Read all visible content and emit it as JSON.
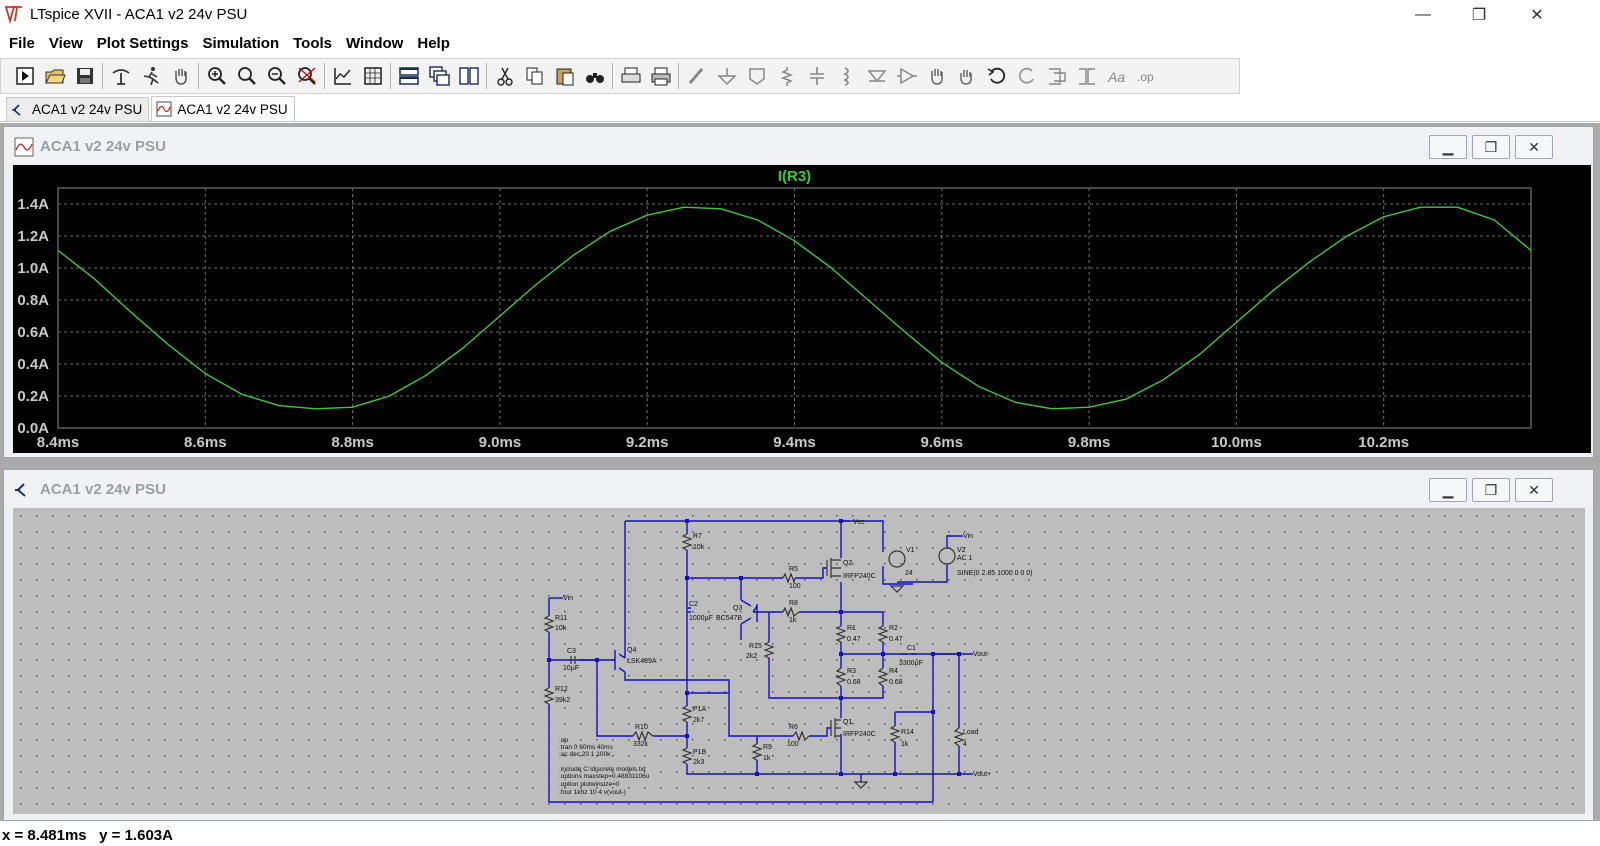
{
  "window": {
    "title": "LTspice XVII - ACA1 v2 24v PSU",
    "controls": {
      "minimize": "—",
      "restore": "❐",
      "close": "✕"
    }
  },
  "menu": [
    "File",
    "View",
    "Plot Settings",
    "Simulation",
    "Tools",
    "Window",
    "Help"
  ],
  "toolbar": {
    "buttons": [
      "run-icon",
      "open-icon",
      "save-icon",
      "control-panel-icon",
      "run-sim-icon",
      "pan-icon",
      "zoom-in-icon",
      "zoom-box-icon",
      "zoom-out-icon",
      "zoom-cancel-icon",
      "autorange-icon",
      "grid-icon",
      "tile-horizontal-icon",
      "cascade-icon",
      "tile-vertical-icon",
      "cut-icon",
      "copy-icon",
      "paste-icon",
      "find-icon",
      "print-setup-icon",
      "print-icon",
      "wire-icon",
      "ground-icon",
      "label-net-icon",
      "resistor-icon",
      "capacitor-icon",
      "inductor-icon",
      "diode-icon",
      "component-icon",
      "move-icon",
      "drag-icon",
      "undo-icon",
      "redo-icon",
      "rotate-icon",
      "mirror-icon",
      "text-icon",
      "spice-directive-icon"
    ]
  },
  "tabs": [
    {
      "label": "ACA1 v2 24v PSU",
      "icon": "schematic-icon"
    },
    {
      "label": "ACA1 v2 24v PSU",
      "icon": "waveform-icon",
      "active": true
    }
  ],
  "plot_window": {
    "title": "ACA1 v2 24v PSU",
    "trace_label": "I(R3)",
    "trace_color": "#3cc83c"
  },
  "schematic_window": {
    "title": "ACA1 v2 24v PSU",
    "wire_color": "#0000c8",
    "labels": {
      "vcc": "Vcc",
      "vin_top": "Vin",
      "vin_left": "Vin",
      "vout_minus": "Vout-",
      "vout_plus": "Vout+",
      "v1": "V1",
      "v1_val": "24",
      "v2": "V2",
      "v2_ac": "AC 1",
      "v2_sine": "SINE(0 2.85 1000 0 0 0)",
      "r7": "R7",
      "r7_val": "10k",
      "r5": "R5",
      "r5_val": "100",
      "q2": "Q2",
      "q2_val": "IRFP240C",
      "c2": "C2",
      "c2_val": "1000µF",
      "q3": "Q3",
      "q3_val": "BC547B",
      "r8": "R8",
      "r8_val": "1k",
      "r11": "R11",
      "r11_val": "10k",
      "c3": "C3",
      "c3_val": "10µF",
      "q4": "Q4",
      "q4_val": "LSK489A",
      "r15": "R15",
      "r15_val": "2k2",
      "r1": "R1",
      "r1_val": "0.47",
      "r2": "R2",
      "r2_val": "0.47",
      "c1": "C1",
      "c1_val": "3300µF",
      "r3": "R3",
      "r3_val": "0.68",
      "r4": "R4",
      "r4_val": "0.68",
      "r12": "R12",
      "r12_val": "39k2",
      "p1a": "P1A",
      "p1a_val": "2k7",
      "r10": "R10",
      "r10_val": "332k",
      "r6": "R6",
      "r6_val": "100",
      "q1": "Q1",
      "q1_val": "IRFP240C",
      "r14": "R14",
      "r14_val": "1k",
      "load": "Load",
      "load_val": "4",
      "r9": "R9",
      "r9_val": "1k",
      "p1b": "P1B",
      "p1b_val": "2k3"
    },
    "directives": [
      ".op",
      ".tran 0 60ms 40ms",
      ";ac dec 20 1 100k",
      ".include C:\\discrete models.txt",
      ".options maxstep=0.48831106u",
      ".option plotwinsize=0",
      ".four 1khz 10 4 v(vout-)"
    ]
  },
  "status": {
    "text": "x = 8.481ms   y = 1.603A"
  },
  "chart_data": {
    "type": "line",
    "title": "I(R3)",
    "xlabel": "",
    "ylabel": "",
    "xlim": [
      8.4,
      10.4
    ],
    "ylim": [
      0.0,
      1.5
    ],
    "x_ticks": [
      "8.4ms",
      "8.6ms",
      "8.8ms",
      "9.0ms",
      "9.2ms",
      "9.4ms",
      "9.6ms",
      "9.8ms",
      "10.0ms",
      "10.2ms"
    ],
    "y_ticks": [
      "0.0A",
      "0.2A",
      "0.4A",
      "0.6A",
      "0.8A",
      "1.0A",
      "1.2A",
      "1.4A"
    ],
    "grid": true,
    "series": [
      {
        "name": "I(R3)",
        "color": "#3cc83c",
        "x": [
          8.4,
          8.45,
          8.5,
          8.55,
          8.6,
          8.65,
          8.7,
          8.75,
          8.8,
          8.85,
          8.9,
          8.95,
          9.0,
          9.05,
          9.1,
          9.15,
          9.2,
          9.25,
          9.3,
          9.35,
          9.4,
          9.45,
          9.5,
          9.55,
          9.6,
          9.65,
          9.7,
          9.75,
          9.8,
          9.85,
          9.9,
          9.95,
          10.0,
          10.05,
          10.1,
          10.15,
          10.2,
          10.25,
          10.3,
          10.35,
          10.4
        ],
        "values": [
          1.11,
          0.93,
          0.72,
          0.52,
          0.34,
          0.21,
          0.14,
          0.12,
          0.13,
          0.2,
          0.33,
          0.5,
          0.7,
          0.9,
          1.08,
          1.23,
          1.33,
          1.38,
          1.37,
          1.3,
          1.17,
          1.0,
          0.8,
          0.6,
          0.41,
          0.26,
          0.16,
          0.12,
          0.13,
          0.18,
          0.3,
          0.46,
          0.66,
          0.86,
          1.04,
          1.2,
          1.32,
          1.38,
          1.38,
          1.3,
          1.11
        ]
      }
    ]
  }
}
